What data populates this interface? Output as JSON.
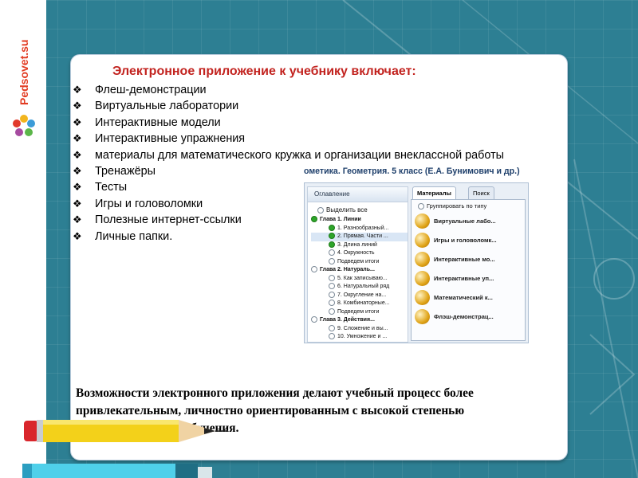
{
  "logo": {
    "text": "Pedsovet.su"
  },
  "card": {
    "title": "Электронное приложение к учебнику включает:",
    "items": [
      "Флеш-демонстрации",
      "Виртуальные лаборатории",
      "Интерактивные модели",
      "Интерактивные упражнения",
      "материалы для математического кружка и организации внеклассной работы",
      "Тренажёры",
      "Тесты",
      "Игры и головоломки",
      "Полезные интернет-ссылки",
      "Личные папки."
    ],
    "bullet": "❖",
    "footer": "Возможности электронного приложения делают учебный процесс более привлекательным, личностно ориентированным с высокой степенью индивидуализации обучения."
  },
  "screenshot": {
    "caption": "ометика. Геометрия. 5 класс (Е.А. Бунимович и др.)",
    "left_header": "Оглавление",
    "select_all": "Выделить все",
    "tree": [
      {
        "label": "Глава 1. Линии",
        "level": 0,
        "dot": "green"
      },
      {
        "label": "1. Разнообразный...",
        "level": 1,
        "dot": "green"
      },
      {
        "label": "2. Прямая. Части ...",
        "level": 1,
        "dot": "green",
        "selected": true
      },
      {
        "label": "3. Длина линий",
        "level": 1,
        "dot": "green"
      },
      {
        "label": "4. Окружность",
        "level": 1,
        "dot": "empty"
      },
      {
        "label": "Подведем итоги",
        "level": 1,
        "dot": "empty"
      },
      {
        "label": "Глава 2. Натураль...",
        "level": 0,
        "dot": "empty"
      },
      {
        "label": "5. Как записываю...",
        "level": 1,
        "dot": "empty"
      },
      {
        "label": "6. Натуральный ряд",
        "level": 1,
        "dot": "empty"
      },
      {
        "label": "7. Округление на...",
        "level": 1,
        "dot": "empty"
      },
      {
        "label": "8. Комбинаторные...",
        "level": 1,
        "dot": "empty"
      },
      {
        "label": "Подведем итоги",
        "level": 1,
        "dot": "empty"
      },
      {
        "label": "Глава 3. Действия...",
        "level": 0,
        "dot": "empty"
      },
      {
        "label": "9. Сложение и вы...",
        "level": 1,
        "dot": "empty"
      },
      {
        "label": "10. Умножение и ...",
        "level": 1,
        "dot": "empty"
      }
    ],
    "tabs": [
      "Материалы",
      "Поиск"
    ],
    "group_label": "Группировать по типу",
    "materials": [
      "Виртуальные лабо...",
      "Игры и головоломк...",
      "Интерактивные мо...",
      "Интерактивные уп...",
      "Математический к...",
      "Флэш-демонстрац..."
    ]
  },
  "colors": {
    "background": "#2d7f93",
    "title": "#c2231f",
    "bullet": "#000000",
    "logo": "#e23b22"
  }
}
